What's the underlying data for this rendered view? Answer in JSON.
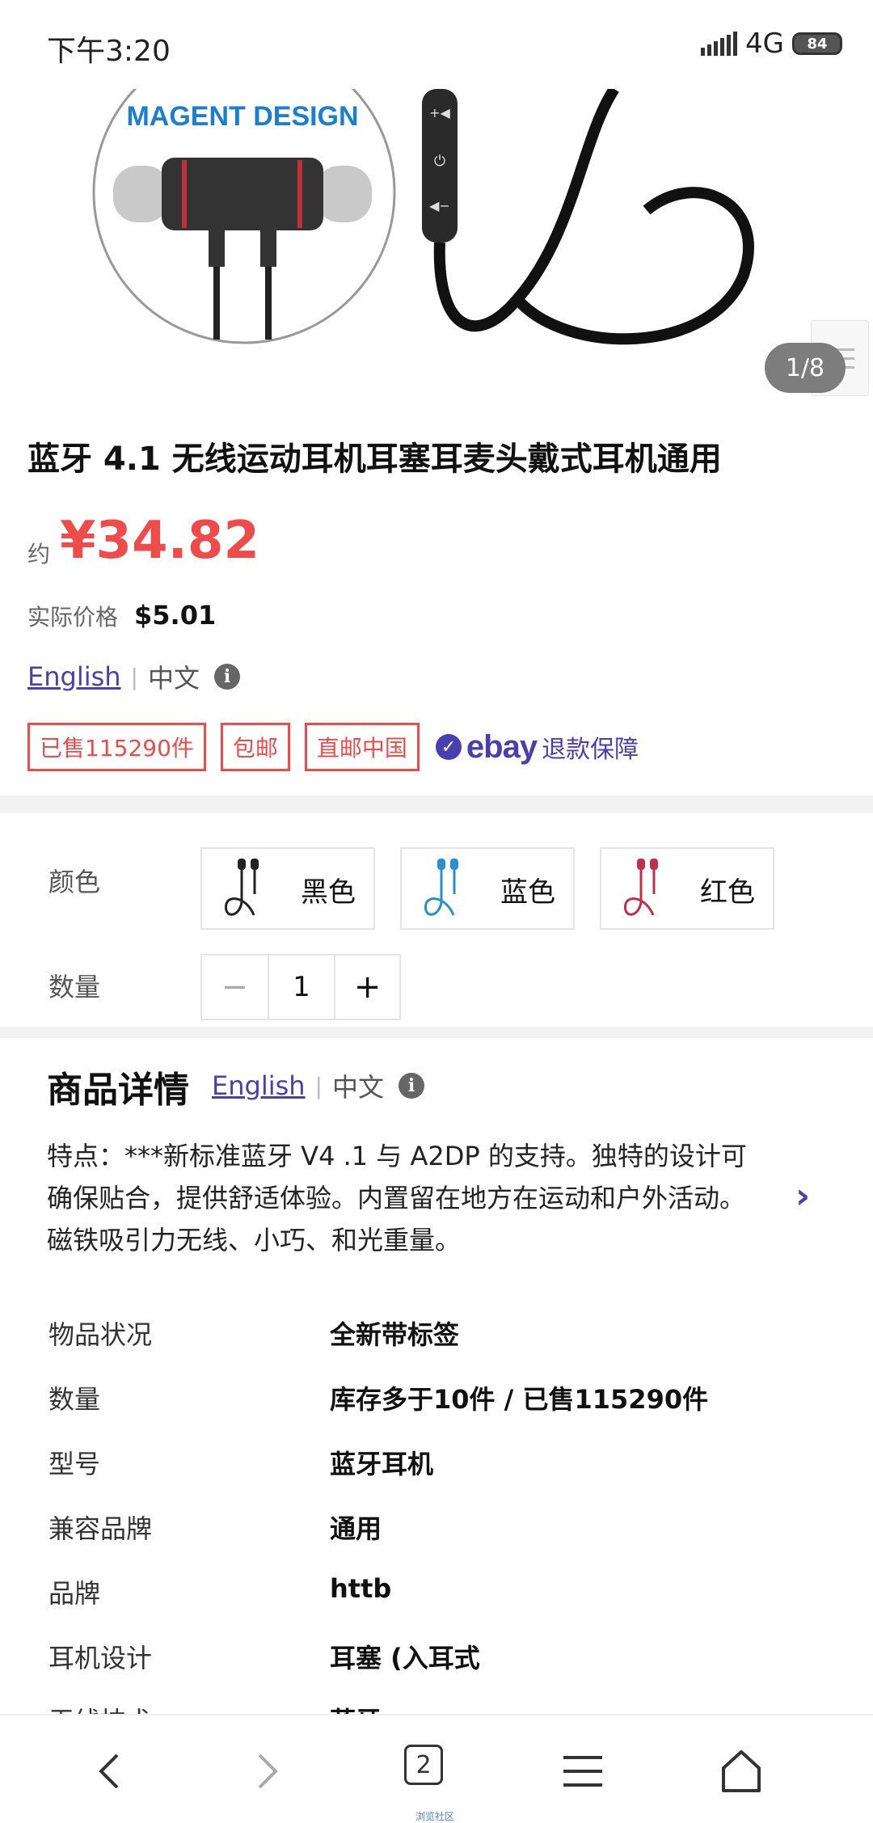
{
  "status_bar": {
    "time": "下午3:20",
    "network": "4G",
    "battery": "84"
  },
  "hero": {
    "banner_text": "MAGENT DESIGN",
    "counter": "1/8"
  },
  "product": {
    "title": "蓝牙 4.1 无线运动耳机耳塞耳麦头戴式耳机通用",
    "price_prefix": "约",
    "price": "¥34.82",
    "actual_price_label": "实际价格",
    "actual_price": "$5.01",
    "lang_en": "English",
    "lang_zh": "中文",
    "tags": [
      "已售115290件",
      "包邮",
      "直邮中国"
    ],
    "ebay_logo": "ebay",
    "ebay_guarantee": "退款保障"
  },
  "options": {
    "color_label": "颜色",
    "colors": [
      {
        "name": "黑色",
        "swatch": "#222222"
      },
      {
        "name": "蓝色",
        "swatch": "#2a8fd0"
      },
      {
        "name": "红色",
        "swatch": "#c0304a"
      }
    ],
    "quantity_label": "数量",
    "quantity": "1",
    "minus": "−",
    "plus": "+"
  },
  "details": {
    "title": "商品详情",
    "lang_en": "English",
    "lang_zh": "中文",
    "description": "特点：***新标准蓝牙 V4 .1 与 A2DP 的支持。独特的设计可确保贴合，提供舒适体验。内置留在地方在运动和户外活动。磁铁吸引力无线、小巧、和光重量。",
    "specs": [
      {
        "key": "物品状况",
        "value": "全新带标签"
      },
      {
        "key": "数量",
        "value": "库存多于10件 / 已售115290件"
      },
      {
        "key": "型号",
        "value": "蓝牙耳机"
      },
      {
        "key": "兼容品牌",
        "value": "通用"
      },
      {
        "key": "品牌",
        "value": "httb"
      },
      {
        "key": "耳机设计",
        "value": "耳塞 (入耳式"
      },
      {
        "key": "无线技术",
        "value": "蓝牙"
      }
    ]
  },
  "bottom_nav": {
    "tab_count": "2",
    "caption": "浏览社区"
  },
  "colors": {
    "price_red": "#f04b4b",
    "ebay_purple": "#4a3fb0"
  }
}
